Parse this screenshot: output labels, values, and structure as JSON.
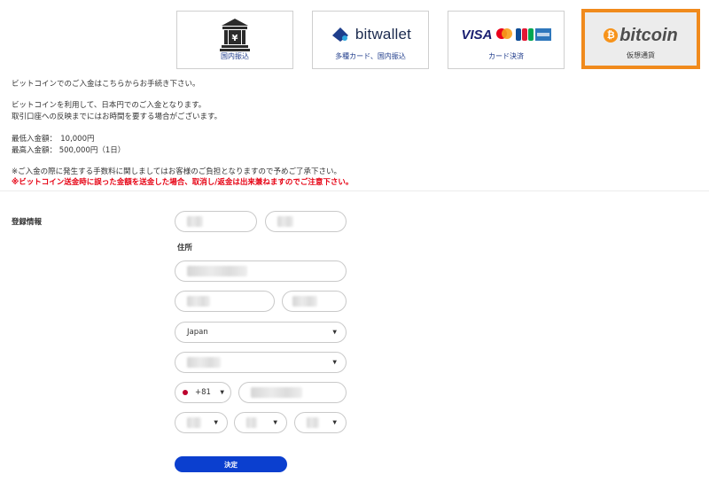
{
  "payment_methods": [
    {
      "id": "bank",
      "label": "国内振込",
      "icon": "bank-icon"
    },
    {
      "id": "bitwallet",
      "label": "多種カード、国内振込",
      "logo_text": "bitwallet",
      "icon": "bitwallet-logo"
    },
    {
      "id": "credit",
      "label": "カード決済",
      "logo_text": "VISA",
      "icon": "card-brands-logo"
    },
    {
      "id": "crypto",
      "label": "仮想通貨",
      "logo_text": "bitcoin",
      "icon": "bitcoin-logo",
      "selected": true
    }
  ],
  "info": {
    "line1": "ビットコインでのご入金はこちらからお手続き下さい。",
    "line2": "ビットコインを利用して、日本円でのご入金となります。",
    "line3": "取引口座への反映までにはお時間を要する場合がございます。",
    "min_deposit": "最低入金額：　10,000円",
    "max_deposit": "最高入金額：  500,000円（1日）",
    "fee_note": "※ご入金の際に発生する手数料に関しましてはお客様のご負担となりますので予めご了承下さい。",
    "warning": "※ビットコイン送金時に誤った金額を送金した場合、取消し/返金は出来兼ねますのでご注意下さい。"
  },
  "form": {
    "section_label": "登録情報",
    "address_label": "住所",
    "country_value": "Japan",
    "phone_code": "+81",
    "submit_label": "決定"
  },
  "colors": {
    "accent_orange": "#f08a1c",
    "submit_blue": "#0b3fcf",
    "warning_red": "#e60012",
    "link_blue": "#1d3a8a"
  }
}
